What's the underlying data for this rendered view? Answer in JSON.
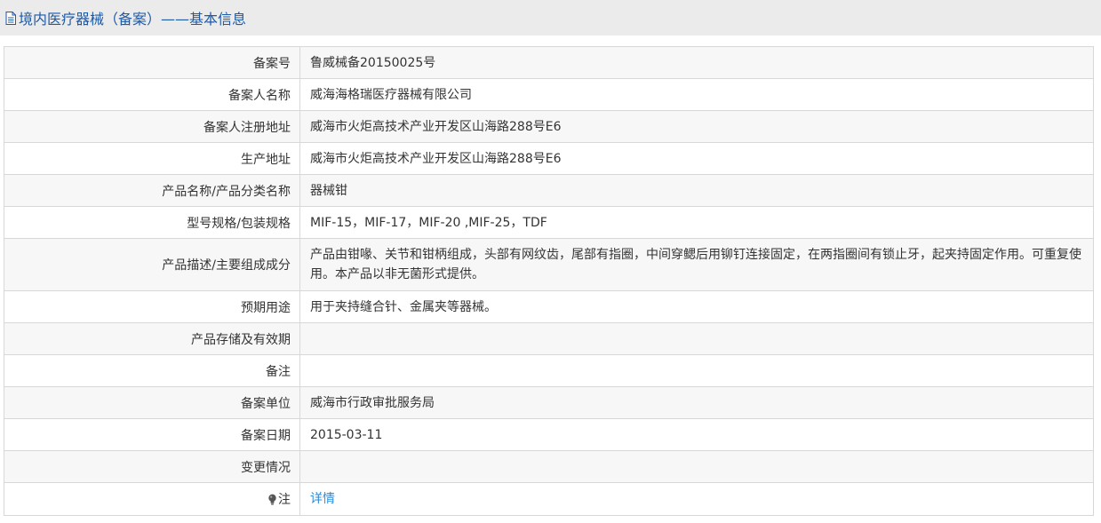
{
  "header": {
    "title": "境内医疗器械（备案）——基本信息",
    "icon": "document-icon"
  },
  "rows": [
    {
      "label": "备案号",
      "value": "鲁威械备20150025号"
    },
    {
      "label": "备案人名称",
      "value": "威海海格瑞医疗器械有限公司"
    },
    {
      "label": "备案人注册地址",
      "value": "威海市火炬高技术产业开发区山海路288号E6"
    },
    {
      "label": "生产地址",
      "value": "威海市火炬高技术产业开发区山海路288号E6"
    },
    {
      "label": "产品名称/产品分类名称",
      "value": "器械钳"
    },
    {
      "label": "型号规格/包装规格",
      "value": "MIF-15，MIF-17，MIF-20 ,MIF-25，TDF"
    },
    {
      "label": "产品描述/主要组成成分",
      "value": "产品由钳喙、关节和钳柄组成，头部有网纹齿，尾部有指圈，中间穿鳃后用铆钉连接固定，在两指圈间有锁止牙，起夹持固定作用。可重复使用。本产品以非无菌形式提供。"
    },
    {
      "label": "预期用途",
      "value": "用于夹持缝合针、金属夹等器械。"
    },
    {
      "label": "产品存储及有效期",
      "value": ""
    },
    {
      "label": "备注",
      "value": ""
    },
    {
      "label": "备案单位",
      "value": "威海市行政审批服务局"
    },
    {
      "label": "备案日期",
      "value": "2015-03-11"
    },
    {
      "label": "变更情况",
      "value": ""
    }
  ],
  "note": {
    "label": "注",
    "icon": "lightbulb-icon",
    "link_text": "详情"
  },
  "colors": {
    "title": "#1e5aa6",
    "link": "#2d8ad6",
    "header_bg": "#ebebeb",
    "row_alt_bg": "#f7f7f7",
    "border": "#d8d8d8"
  }
}
